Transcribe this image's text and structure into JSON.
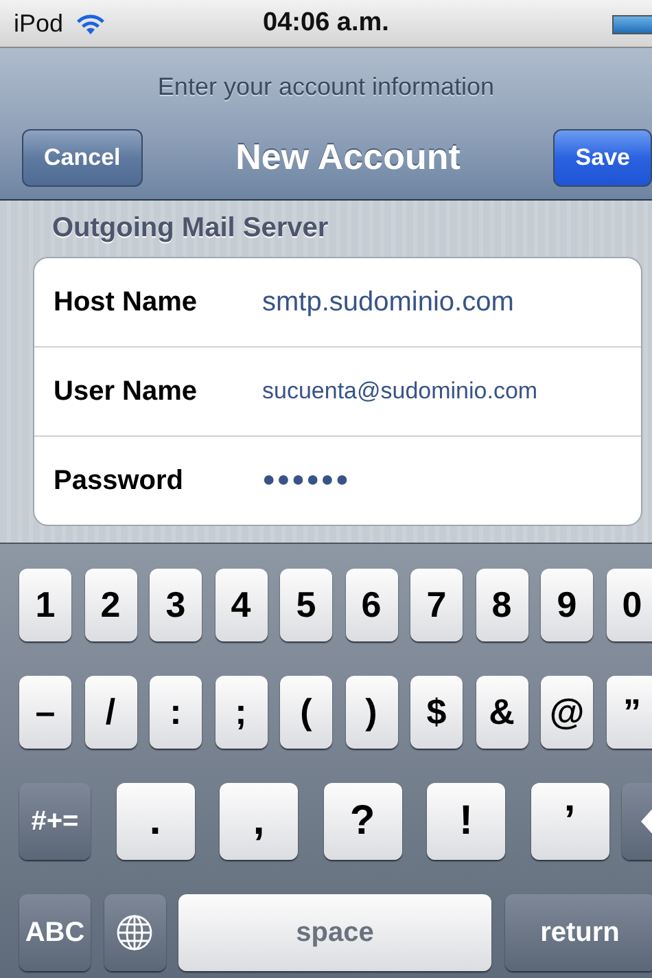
{
  "status_bar": {
    "carrier": "iPod",
    "time": "04:06 a.m."
  },
  "nav_bar": {
    "prompt": "Enter your account information",
    "title": "New Account",
    "left_button": "Cancel",
    "right_button": "Save"
  },
  "section": {
    "header": "Outgoing Mail Server",
    "fields": [
      {
        "label": "Host Name",
        "value": "smtp.sudominio.com",
        "kind": "text"
      },
      {
        "label": "User Name",
        "value": "sucuenta@sudominio.com",
        "kind": "small"
      },
      {
        "label": "Password",
        "value": "●●●●●●",
        "kind": "secure"
      }
    ]
  },
  "keyboard": {
    "rows": [
      {
        "keys": [
          {
            "label": "1",
            "kind": "char"
          },
          {
            "label": "2",
            "kind": "char"
          },
          {
            "label": "3",
            "kind": "char"
          },
          {
            "label": "4",
            "kind": "char"
          },
          {
            "label": "5",
            "kind": "char"
          },
          {
            "label": "6",
            "kind": "char"
          },
          {
            "label": "7",
            "kind": "char"
          },
          {
            "label": "8",
            "kind": "char"
          },
          {
            "label": "9",
            "kind": "char"
          },
          {
            "label": "0",
            "kind": "char"
          }
        ]
      },
      {
        "keys": [
          {
            "label": "–",
            "kind": "char"
          },
          {
            "label": "/",
            "kind": "char"
          },
          {
            "label": ":",
            "kind": "char"
          },
          {
            "label": ";",
            "kind": "char"
          },
          {
            "label": "(",
            "kind": "char"
          },
          {
            "label": ")",
            "kind": "char"
          },
          {
            "label": "$",
            "kind": "char"
          },
          {
            "label": "&",
            "kind": "char"
          },
          {
            "label": "@",
            "kind": "char"
          },
          {
            "label": "”",
            "kind": "char"
          }
        ]
      },
      {
        "keys": [
          {
            "label": "#+=",
            "kind": "function"
          },
          {
            "label": ".",
            "kind": "wide"
          },
          {
            "label": ",",
            "kind": "wide"
          },
          {
            "label": "?",
            "kind": "wide"
          },
          {
            "label": "!",
            "kind": "wide"
          },
          {
            "label": "’",
            "kind": "wide"
          },
          {
            "kind": "delete"
          }
        ]
      },
      {
        "keys": [
          {
            "label": "ABC",
            "kind": "function"
          },
          {
            "kind": "globe"
          },
          {
            "label": "space",
            "kind": "space"
          },
          {
            "label": "return",
            "kind": "return"
          }
        ]
      }
    ]
  }
}
